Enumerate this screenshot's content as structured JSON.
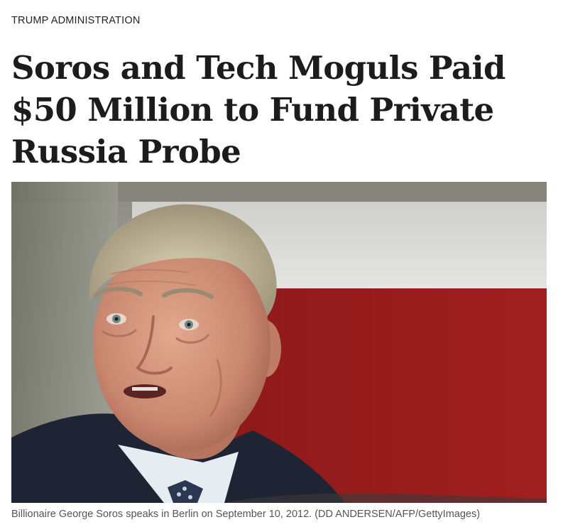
{
  "article": {
    "section": "TRUMP ADMINISTRATION",
    "headline": "Soros and Tech Moguls Paid $50 Million to Fund Private Russia Probe",
    "caption": "Billionaire George Soros speaks in Berlin on September 10, 2012. (DD ANDERSEN/AFP/GettyImages)"
  }
}
